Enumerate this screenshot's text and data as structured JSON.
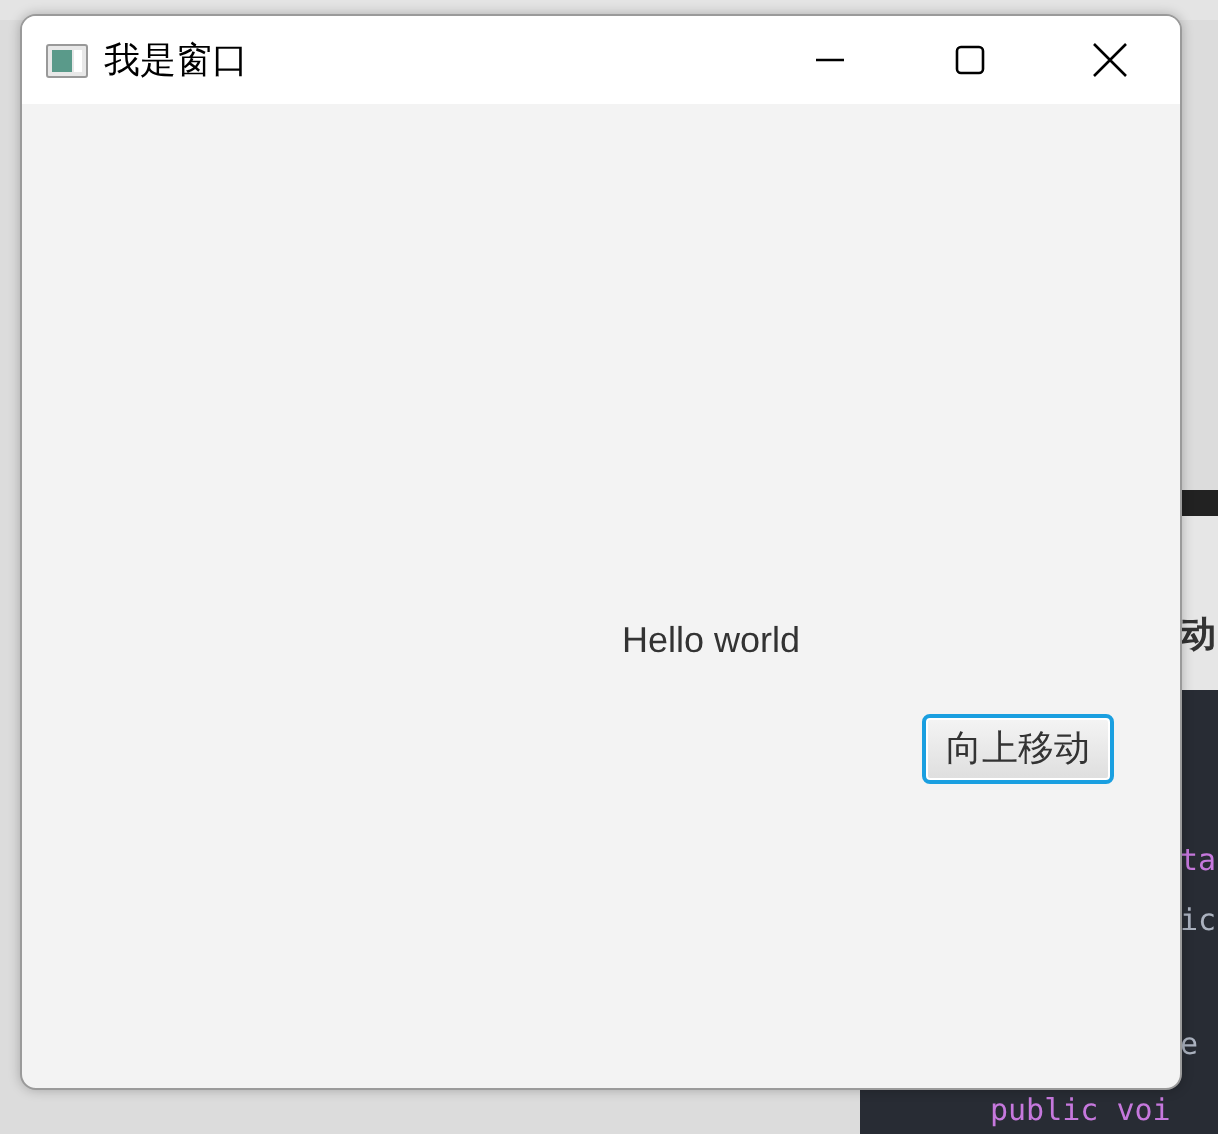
{
  "background": {
    "heading": "动",
    "code_lines": [
      {
        "text": "ta",
        "kind": "keyword"
      },
      {
        "text": "ic",
        "kind": "plain"
      },
      {
        "text": "e",
        "kind": "plain"
      },
      {
        "text": "public voi",
        "kind": "keyword"
      }
    ]
  },
  "window": {
    "title": "我是窗口"
  },
  "content": {
    "label": "Hello world",
    "button": {
      "label": "向上移动",
      "focused": true
    }
  }
}
